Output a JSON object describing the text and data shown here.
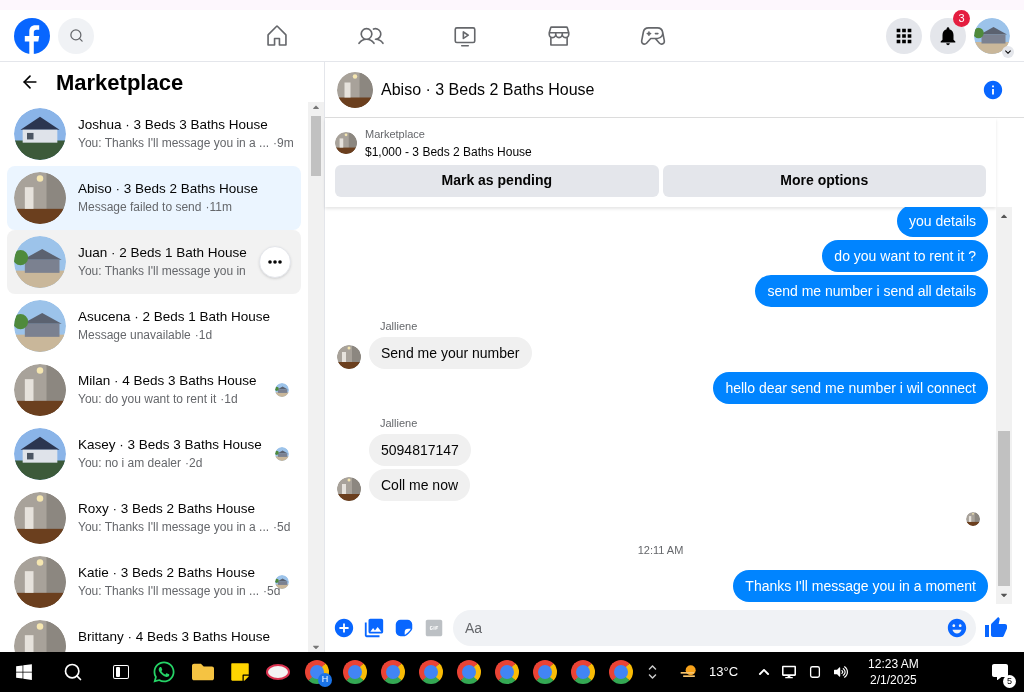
{
  "header": {
    "notifications_badge": "3"
  },
  "sidebar": {
    "title": "Marketplace",
    "conversations": [
      {
        "title": "Joshua · 3 Beds 3 Baths House",
        "preview": "You: Thanks I'll message you in a ...",
        "time": "·9m",
        "selected": false,
        "hovered": false,
        "seen_avatar": false
      },
      {
        "title": "Abiso · 3 Beds 2 Baths House",
        "preview": "Message failed to send",
        "time": "·11m",
        "selected": true,
        "hovered": false,
        "seen_avatar": false
      },
      {
        "title": "Juan · 2 Beds 1 Bath House",
        "preview": "You: Thanks I'll message you in",
        "selected": false,
        "hovered": true,
        "seen_avatar": false
      },
      {
        "title": "Asucena · 2 Beds 1 Bath House",
        "preview": "Message unavailable",
        "time": "·1d",
        "selected": false,
        "hovered": false,
        "seen_avatar": false
      },
      {
        "title": "Milan · 4 Beds 3 Baths House",
        "preview": "You: do you want to rent it",
        "time": "·1d",
        "selected": false,
        "hovered": false,
        "seen_avatar": true
      },
      {
        "title": "Kasey · 3 Beds 3 Baths House",
        "preview": "You: no i am dealer",
        "time": "·2d",
        "selected": false,
        "hovered": false,
        "seen_avatar": true
      },
      {
        "title": "Roxy · 3 Beds 2 Baths House",
        "preview": "You: Thanks I'll message you in a ...",
        "time": "·5d",
        "selected": false,
        "hovered": false,
        "seen_avatar": false
      },
      {
        "title": "Katie · 3 Beds 2 Baths House",
        "preview": "You: Thanks I'll message you in ...",
        "time": "·5d",
        "selected": false,
        "hovered": false,
        "seen_avatar": true
      },
      {
        "title": "Brittany · 4 Beds 3 Baths House",
        "selected": false,
        "hovered": false,
        "seen_avatar": false
      }
    ]
  },
  "chat": {
    "title": "Abiso · 3 Beds 2 Baths House",
    "listing": {
      "label": "Marketplace",
      "price_title": "$1,000 - 3 Beds 2 Baths House"
    },
    "buttons": [
      "Mark as pending",
      "More options"
    ],
    "messages": [
      {
        "kind": "out",
        "text": "you details"
      },
      {
        "kind": "out",
        "text": "do you want to rent it ?"
      },
      {
        "kind": "out",
        "text": "send me number i send all details"
      },
      {
        "kind": "sender",
        "text": "Jalliene"
      },
      {
        "kind": "in",
        "text": "Send me your number",
        "avatar": true
      },
      {
        "kind": "out",
        "text": "hello dear send me number i wil connect"
      },
      {
        "kind": "sender",
        "text": "Jalliene"
      },
      {
        "kind": "in",
        "text": "5094817147",
        "avatar": false
      },
      {
        "kind": "in",
        "text": "Coll me now",
        "avatar": true
      },
      {
        "kind": "seen"
      },
      {
        "kind": "time",
        "text": "12:11 AM"
      },
      {
        "kind": "out",
        "text": "Thanks I'll message you in a moment"
      }
    ],
    "composer": {
      "placeholder": "Aa"
    }
  },
  "taskbar": {
    "browser_badge": "H",
    "weather": "13°C",
    "time": "12:23 AM",
    "date": "2/1/2025",
    "notification_count": "5"
  }
}
